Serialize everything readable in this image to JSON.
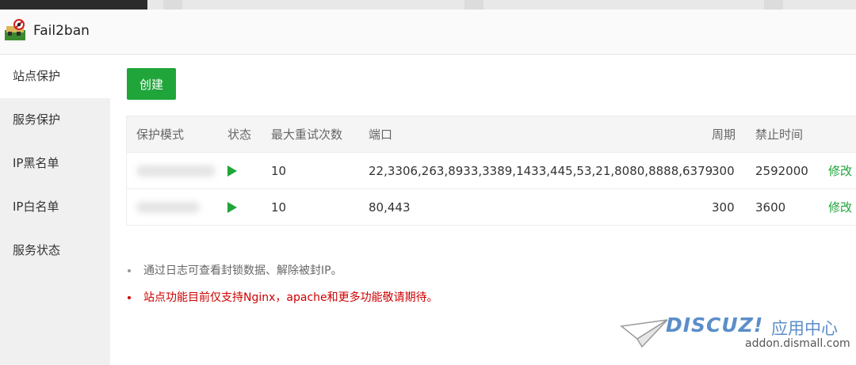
{
  "app": {
    "title": "Fail2ban",
    "icon": "fail2ban-app-icon"
  },
  "sidebar": {
    "items": [
      {
        "label": "站点保护",
        "active": true
      },
      {
        "label": "服务保护",
        "active": false
      },
      {
        "label": "IP黑名单",
        "active": false
      },
      {
        "label": "IP白名单",
        "active": false
      },
      {
        "label": "服务状态",
        "active": false
      }
    ]
  },
  "toolbar": {
    "create_label": "创建"
  },
  "table": {
    "headers": [
      "保护模式",
      "状态",
      "最大重试次数",
      "端口",
      "周期",
      "禁止时间",
      ""
    ],
    "rows": [
      {
        "mode": "",
        "status_icon": "play-icon",
        "max_retry": "10",
        "ports": "22,3306,263,8933,3389,1433,445,53,21,8080,8888,6379",
        "period": "300",
        "ban_time": "2592000",
        "action": "修改"
      },
      {
        "mode": "",
        "status_icon": "play-icon",
        "max_retry": "10",
        "ports": "80,443",
        "period": "300",
        "ban_time": "3600",
        "action": "修改"
      }
    ]
  },
  "notes": [
    {
      "text": "通过日志可查看封锁数据、解除被封IP。",
      "color": "#666666"
    },
    {
      "text": "站点功能目前仅支持Nginx，apache和更多功能敬请期待。",
      "color": "#cc0000"
    }
  ],
  "watermark": {
    "brand": "DISCUZ!",
    "cn": "应用中心",
    "url": "addon.dismall.com"
  },
  "colors": {
    "accent": "#20a53a",
    "warning": "#cc0000",
    "watermark": "#5b8ec9"
  }
}
